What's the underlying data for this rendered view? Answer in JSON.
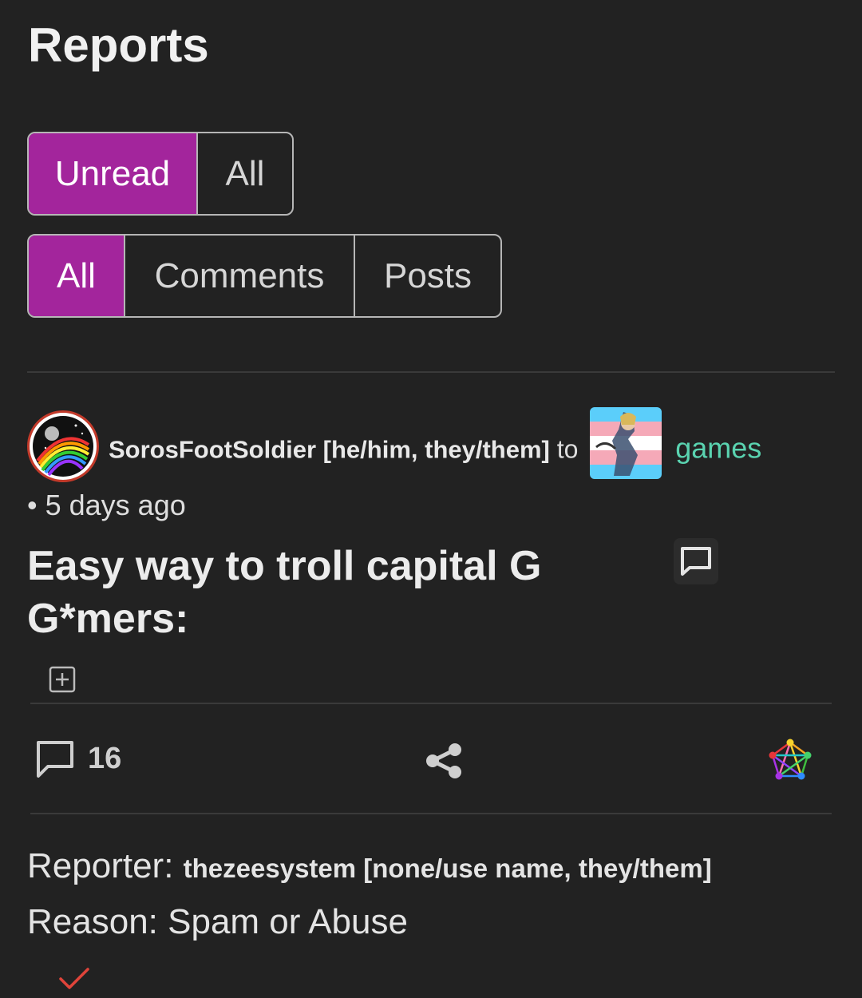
{
  "page": {
    "title": "Reports"
  },
  "filters": {
    "read_state": {
      "options": [
        "Unread",
        "All"
      ],
      "selected": "Unread"
    },
    "content_type": {
      "options": [
        "All",
        "Comments",
        "Posts"
      ],
      "selected": "All"
    }
  },
  "report": {
    "post": {
      "author": "SorosFootSoldier [he/him, they/them]",
      "to_label": "to",
      "community": "games",
      "time": "• 5 days ago",
      "title": "Easy way to troll capital G G*mers:",
      "comment_count": "16"
    },
    "reporter_label": "Reporter:",
    "reporter": "thezeesystem [none/use name, they/them]",
    "reason_label": "Reason:",
    "reason": "Spam or Abuse"
  },
  "colors": {
    "accent": "#a3259c",
    "community": "#5ad3b0",
    "background": "#222222",
    "resolve": "#e0443a"
  }
}
